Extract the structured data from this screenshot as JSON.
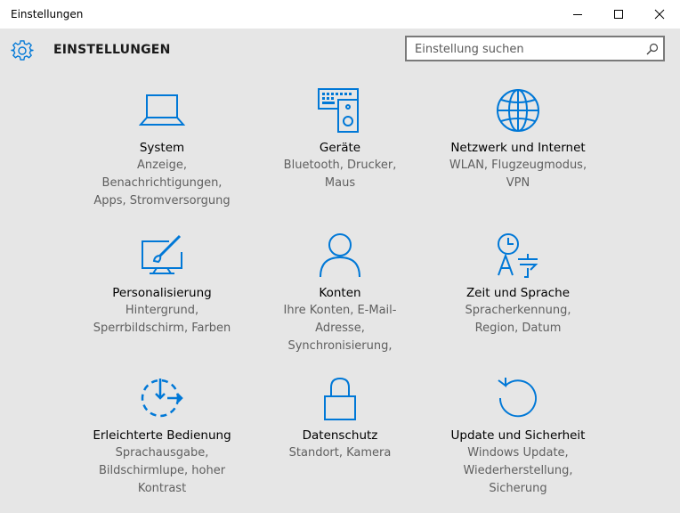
{
  "window": {
    "title": "Einstellungen"
  },
  "header": {
    "title": "EINSTELLUNGEN",
    "search_placeholder": "Einstellung suchen"
  },
  "colors": {
    "accent": "#0078d7",
    "background": "#e6e6e6"
  },
  "tiles": [
    {
      "name": "System",
      "desc": "Anzeige,\nBenachrichtigungen,\nApps, Stromversorgung",
      "icon": "laptop-icon"
    },
    {
      "name": "Geräte",
      "desc": "Bluetooth, Drucker,\nMaus",
      "icon": "devices-icon"
    },
    {
      "name": "Netzwerk und Internet",
      "desc": "WLAN, Flugzeugmodus,\nVPN",
      "icon": "globe-icon"
    },
    {
      "name": "Personalisierung",
      "desc": "Hintergrund,\nSperrbildschirm, Farben",
      "icon": "personalization-icon"
    },
    {
      "name": "Konten",
      "desc": "Ihre Konten, E-Mail-\nAdresse,\nSynchronisierung,",
      "icon": "person-icon"
    },
    {
      "name": "Zeit und Sprache",
      "desc": "Spracherkennung,\nRegion, Datum",
      "icon": "time-language-icon"
    },
    {
      "name": "Erleichterte Bedienung",
      "desc": "Sprachausgabe,\nBildschirmlupe, hoher\nKontrast",
      "icon": "ease-of-access-icon"
    },
    {
      "name": "Datenschutz",
      "desc": "Standort, Kamera",
      "icon": "lock-icon"
    },
    {
      "name": "Update und Sicherheit",
      "desc": "Windows Update,\nWiederherstellung,\nSicherung",
      "icon": "refresh-icon"
    }
  ]
}
